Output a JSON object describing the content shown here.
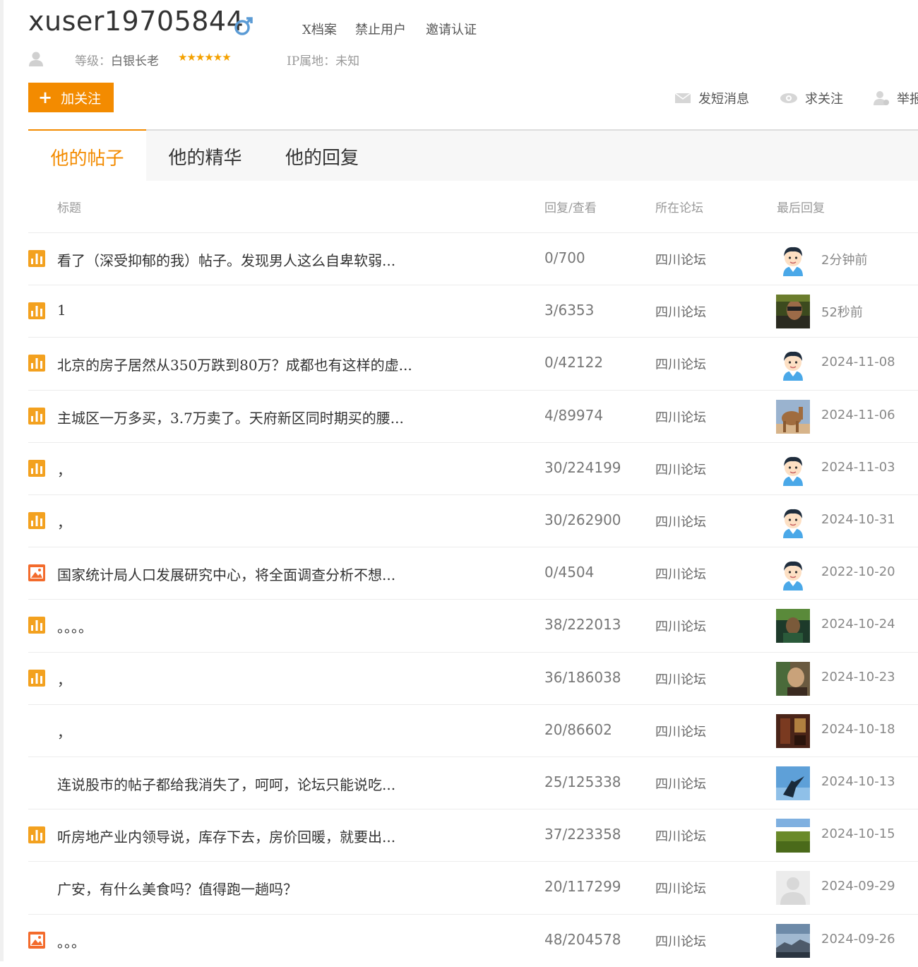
{
  "profile": {
    "username": "xuser19705844",
    "links": [
      "X档案",
      "禁止用户",
      "邀请认证"
    ],
    "level_label": "等级：",
    "level_value": "白银长老",
    "stars": "★★★★★★",
    "ip_label": "IP属地：",
    "ip_value": "未知"
  },
  "actions": {
    "follow": "加关注",
    "message": "发短消息",
    "seek_follow": "求关注",
    "report": "举报"
  },
  "tabs": [
    "他的帖子",
    "他的精华",
    "他的回复"
  ],
  "columns": {
    "title": "标题",
    "stats": "回复/查看",
    "forum": "所在论坛",
    "last_reply": "最后回复"
  },
  "rows": [
    {
      "icon": "bar-chart-icon",
      "title": "看了（深受抑郁的我）帖子。发现男人这么自卑软弱...",
      "stats": "0/700",
      "forum": "四川论坛",
      "time": "2分钟前",
      "avatar": "cartoon-avatar-icon"
    },
    {
      "icon": "bar-chart-icon",
      "title": "1",
      "stats": "3/6353",
      "forum": "四川论坛",
      "time": "52秒前",
      "avatar": "photo-avatar-man"
    },
    {
      "icon": "bar-chart-icon",
      "title": "北京的房子居然从350万跌到80万？成都也有这样的虚...",
      "stats": "0/42122",
      "forum": "四川论坛",
      "time": "2024-11-08",
      "avatar": "cartoon-avatar-icon"
    },
    {
      "icon": "bar-chart-icon",
      "title": "主城区一万多买，3.7万卖了。天府新区同时期买的腰...",
      "stats": "4/89974",
      "forum": "四川论坛",
      "time": "2024-11-06",
      "avatar": "photo-avatar-camel"
    },
    {
      "icon": "bar-chart-icon",
      "title": "，",
      "stats": "30/224199",
      "forum": "四川论坛",
      "time": "2024-11-03",
      "avatar": "cartoon-avatar-icon"
    },
    {
      "icon": "bar-chart-icon",
      "title": "，",
      "stats": "30/262900",
      "forum": "四川论坛",
      "time": "2024-10-31",
      "avatar": "cartoon-avatar-icon"
    },
    {
      "icon": "image-icon",
      "title": "国家统计局人口发展研究中心，将全面调查分析不想...",
      "stats": "0/4504",
      "forum": "四川论坛",
      "time": "2022-10-20",
      "avatar": "cartoon-avatar-icon"
    },
    {
      "icon": "bar-chart-icon",
      "title": "。。。。",
      "stats": "38/222013",
      "forum": "四川论坛",
      "time": "2024-10-24",
      "avatar": "photo-avatar-green"
    },
    {
      "icon": "bar-chart-icon",
      "title": "，",
      "stats": "36/186038",
      "forum": "四川论坛",
      "time": "2024-10-23",
      "avatar": "photo-avatar-person"
    },
    {
      "icon": "",
      "title": "，",
      "stats": "20/86602",
      "forum": "四川论坛",
      "time": "2024-10-18",
      "avatar": "photo-avatar-room"
    },
    {
      "icon": "",
      "title": "连说股市的帖子都给我消失了，呵呵，论坛只能说吃...",
      "stats": "25/125338",
      "forum": "四川论坛",
      "time": "2024-10-13",
      "avatar": "photo-avatar-sky"
    },
    {
      "icon": "bar-chart-icon",
      "title": "听房地产业内领导说，库存下去，房价回暖，就要出...",
      "stats": "37/223358",
      "forum": "四川论坛",
      "time": "2024-10-15",
      "avatar": "photo-avatar-field"
    },
    {
      "icon": "",
      "title": "广安，有什么美食吗？值得跑一趟吗？",
      "stats": "20/117299",
      "forum": "四川论坛",
      "time": "2024-09-29",
      "avatar": "default-avatar-icon"
    },
    {
      "icon": "image-icon",
      "title": "。。。",
      "stats": "48/204578",
      "forum": "四川论坛",
      "time": "2024-09-26",
      "avatar": "photo-avatar-mountain"
    }
  ],
  "colors": {
    "accent": "#f38b00",
    "muted": "#999999"
  }
}
